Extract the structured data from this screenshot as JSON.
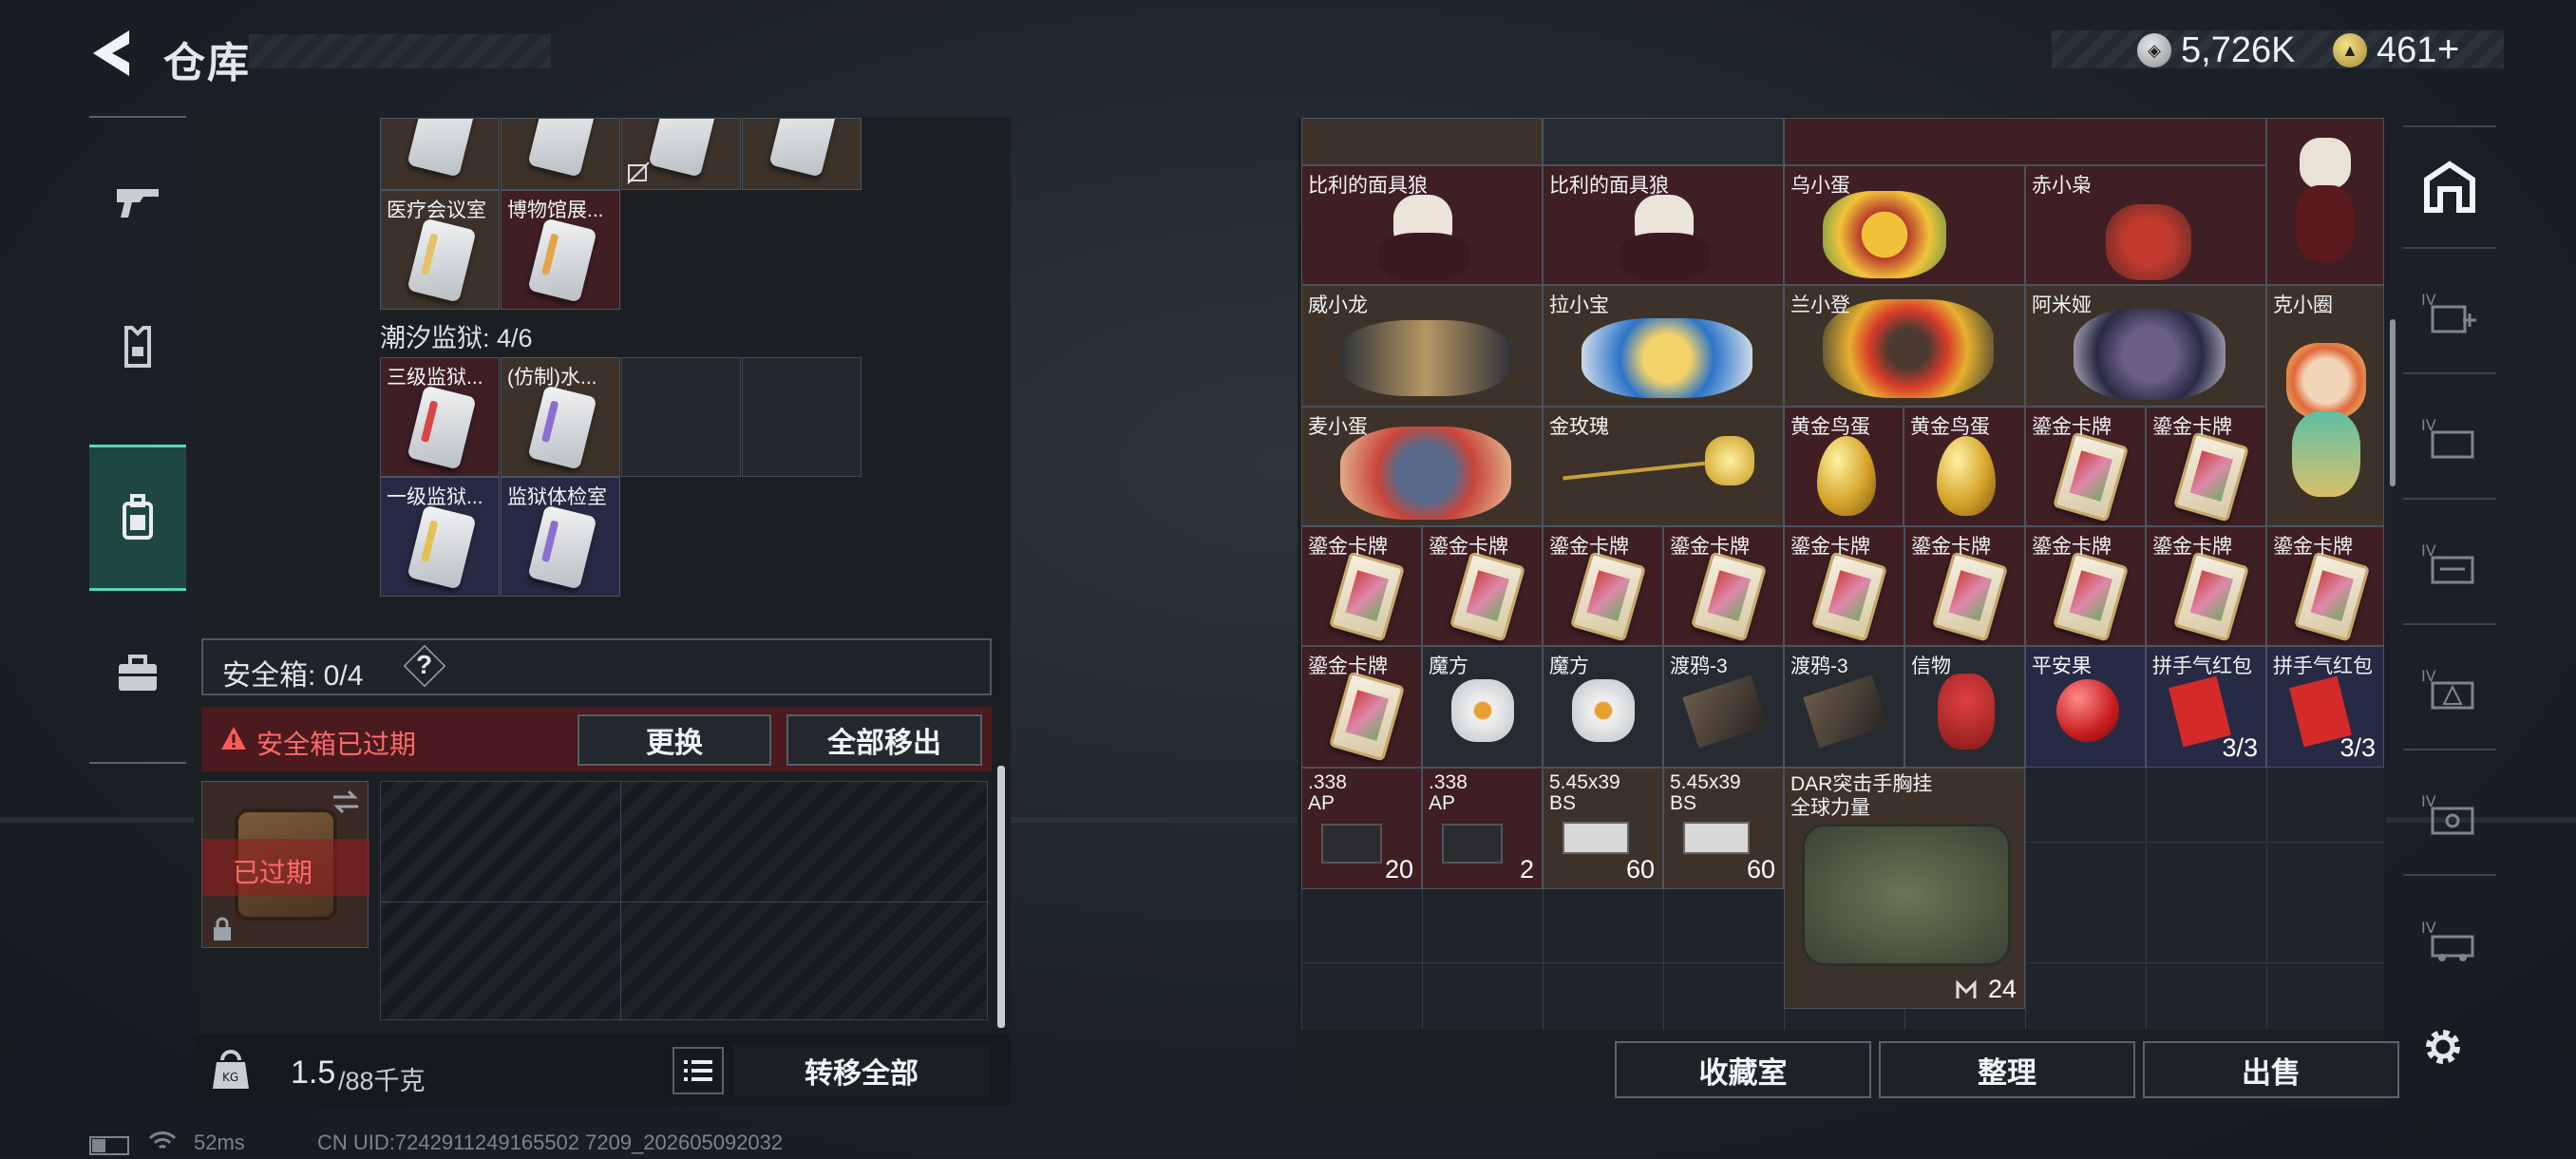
{
  "header": {
    "title": "仓库",
    "currency1": "5,726K",
    "currency2": "461",
    "currency2_plus": "+"
  },
  "nav": {
    "items": [
      "weapon",
      "armor",
      "backpack",
      "toolbox"
    ],
    "active": 2
  },
  "left": {
    "top_items": [
      {
        "label": "医疗会议室"
      },
      {
        "label": "博物馆展..."
      }
    ],
    "section_title": "潮汐监狱: 4/6",
    "prison_items": [
      {
        "label": "三级监狱..."
      },
      {
        "label": "(仿制)水..."
      },
      {
        "label": "一级监狱..."
      },
      {
        "label": "监狱体检室"
      }
    ],
    "safebox_label": "安全箱: 0/4",
    "help": "?",
    "expired_text": "安全箱已过期",
    "replace_button": "更换",
    "move_all_out_button": "全部移出",
    "box_expired_label": "已过期",
    "weight_current": "1.5",
    "weight_max": "/88千克",
    "transfer_all_button": "转移全部"
  },
  "right": {
    "row1": [
      "比利的面具狼",
      "比利的面具狼",
      "乌小蛋",
      "赤小枭"
    ],
    "row2": [
      "威小龙",
      "拉小宝",
      "兰小登",
      "阿米娅",
      "克小圈"
    ],
    "row3": [
      "麦小蛋",
      "金玫瑰",
      "黄金鸟蛋",
      "黄金鸟蛋",
      "鎏金卡牌",
      "鎏金卡牌"
    ],
    "row4": [
      "鎏金卡牌",
      "鎏金卡牌",
      "鎏金卡牌",
      "鎏金卡牌",
      "鎏金卡牌",
      "鎏金卡牌",
      "鎏金卡牌",
      "鎏金卡牌",
      "鎏金卡牌"
    ],
    "row5": [
      "鎏金卡牌",
      "魔方",
      "魔方",
      "渡鸦-3",
      "渡鸦-3",
      "信物",
      "平安果",
      "拼手气红包",
      "拼手气红包"
    ],
    "row5_counts": [
      "3/3",
      "3/3"
    ],
    "ammo": [
      {
        "l1": ".338",
        "l2": "AP",
        "count": "20"
      },
      {
        "l1": ".338",
        "l2": "AP",
        "count": "2"
      },
      {
        "l1": "5.45x39",
        "l2": "BS",
        "count": "60"
      },
      {
        "l1": "5.45x39",
        "l2": "BS",
        "count": "60"
      }
    ],
    "bag_label": "DAR突击手胸挂\n全球力量",
    "bag_count": "24",
    "collection_button": "收藏室",
    "arrange_button": "整理",
    "sell_button": "出售"
  },
  "status": {
    "ping": "52ms",
    "uid": "CN UID:7242911249165502 7209_202605092032"
  }
}
